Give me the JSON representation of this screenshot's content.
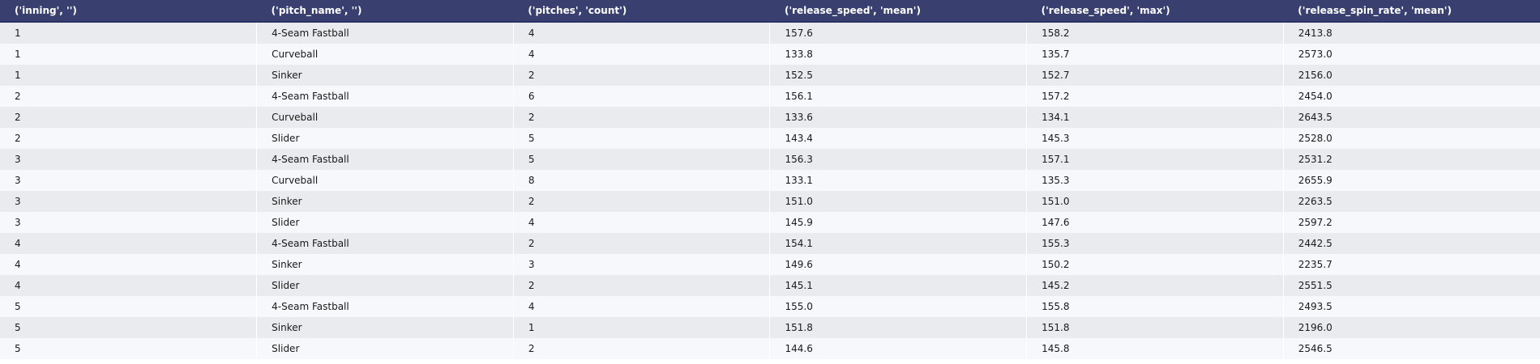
{
  "table": {
    "columns": [
      "('inning', '')",
      "('pitch_name', '')",
      "('pitches', 'count')",
      "('release_speed', 'mean')",
      "('release_speed', 'max')",
      "('release_spin_rate', 'mean')"
    ],
    "rows": [
      [
        "1",
        "4-Seam Fastball",
        "4",
        "157.6",
        "158.2",
        "2413.8"
      ],
      [
        "1",
        "Curveball",
        "4",
        "133.8",
        "135.7",
        "2573.0"
      ],
      [
        "1",
        "Sinker",
        "2",
        "152.5",
        "152.7",
        "2156.0"
      ],
      [
        "2",
        "4-Seam Fastball",
        "6",
        "156.1",
        "157.2",
        "2454.0"
      ],
      [
        "2",
        "Curveball",
        "2",
        "133.6",
        "134.1",
        "2643.5"
      ],
      [
        "2",
        "Slider",
        "5",
        "143.4",
        "145.3",
        "2528.0"
      ],
      [
        "3",
        "4-Seam Fastball",
        "5",
        "156.3",
        "157.1",
        "2531.2"
      ],
      [
        "3",
        "Curveball",
        "8",
        "133.1",
        "135.3",
        "2655.9"
      ],
      [
        "3",
        "Sinker",
        "2",
        "151.0",
        "151.0",
        "2263.5"
      ],
      [
        "3",
        "Slider",
        "4",
        "145.9",
        "147.6",
        "2597.2"
      ],
      [
        "4",
        "4-Seam Fastball",
        "2",
        "154.1",
        "155.3",
        "2442.5"
      ],
      [
        "4",
        "Sinker",
        "3",
        "149.6",
        "150.2",
        "2235.7"
      ],
      [
        "4",
        "Slider",
        "2",
        "145.1",
        "145.2",
        "2551.5"
      ],
      [
        "5",
        "4-Seam Fastball",
        "4",
        "155.0",
        "155.8",
        "2493.5"
      ],
      [
        "5",
        "Sinker",
        "1",
        "151.8",
        "151.8",
        "2196.0"
      ],
      [
        "5",
        "Slider",
        "2",
        "144.6",
        "145.8",
        "2546.5"
      ]
    ]
  }
}
